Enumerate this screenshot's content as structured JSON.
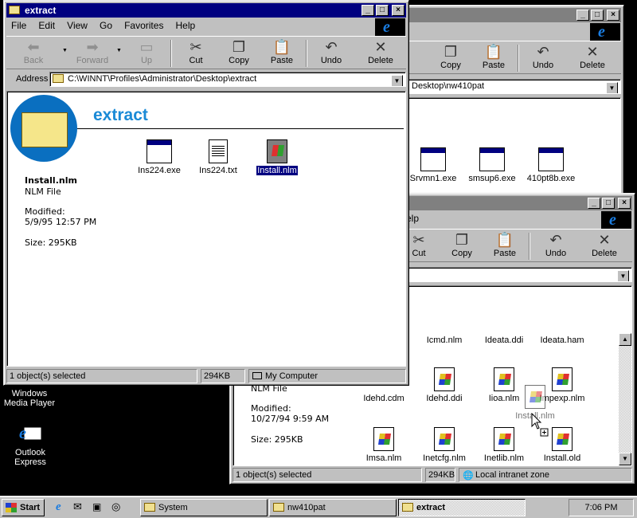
{
  "desktop": {
    "icons": [
      {
        "label_line1": "Windows",
        "label_line2": "Media Player"
      },
      {
        "label_line1": "Outlook",
        "label_line2": "Express"
      }
    ]
  },
  "win_nw410pat": {
    "address": "Desktop\\nw410pat",
    "toolbar": [
      "Copy",
      "Paste",
      "Undo",
      "Delete"
    ],
    "files": [
      "Srvmn1.exe",
      "smsup6.exe",
      "410pt8b.exe"
    ]
  },
  "win_system": {
    "title_fragment": "elp",
    "toolbar": [
      "Cut",
      "Copy",
      "Paste",
      "Undo",
      "Delete"
    ],
    "info_line_file": "NLM File",
    "info_modified_label": "Modified:",
    "info_modified_value": "10/27/94 9:59 AM",
    "info_size": "Size: 295KB",
    "files_row1": [
      "Icmd.nlm",
      "Ideata.ddi",
      "Ideata.ham"
    ],
    "files_row2": [
      "Idehd.cdm",
      "Idehd.ddi",
      "Iioa.nlm",
      "Impexp.nlm"
    ],
    "files_row3": [
      "Imsa.nlm",
      "Inetcfg.nlm",
      "Inetlib.nlm",
      "Install.old"
    ],
    "drag_ghost_label": "Install.nlm",
    "status": [
      "1 object(s) selected",
      "294KB",
      "Local intranet zone"
    ]
  },
  "win_extract": {
    "title": "extract",
    "menu": [
      "File",
      "Edit",
      "View",
      "Go",
      "Favorites",
      "Help"
    ],
    "toolbar": {
      "back": "Back",
      "forward": "Forward",
      "up": "Up",
      "cut": "Cut",
      "copy": "Copy",
      "paste": "Paste",
      "undo": "Undo",
      "delete": "Delete"
    },
    "address_label": "Address",
    "address_value": "C:\\WINNT\\Profiles\\Administrator\\Desktop\\extract",
    "folder_heading": "extract",
    "selected_name": "Install.nlm",
    "selected_type": "NLM File",
    "modified_label": "Modified:",
    "modified_value": "5/9/95 12:57 PM",
    "size": "Size: 295KB",
    "files": [
      "Ins224.exe",
      "Ins224.txt",
      "Install.nlm"
    ],
    "status": [
      "1 object(s) selected",
      "294KB",
      "My Computer"
    ]
  },
  "taskbar": {
    "start": "Start",
    "tasks": [
      "System",
      "nw410pat",
      "extract"
    ],
    "clock": "7:06 PM"
  }
}
